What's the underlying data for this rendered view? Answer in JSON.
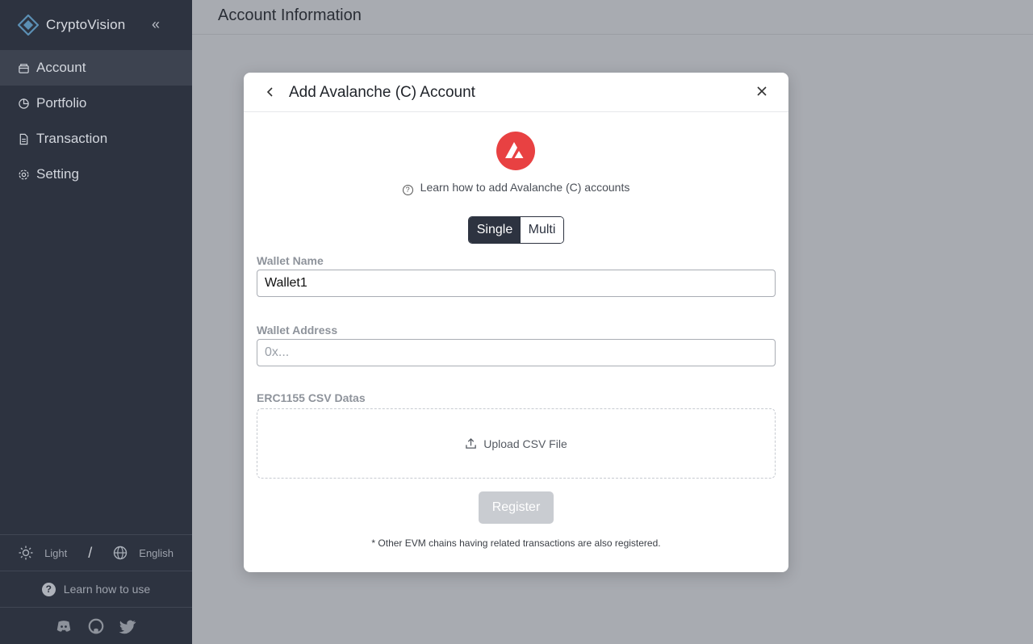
{
  "app": {
    "name": "CryptoVision"
  },
  "sidebar": {
    "items": [
      {
        "label": "Account",
        "icon": "wallet-icon",
        "active": true
      },
      {
        "label": "Portfolio",
        "icon": "pie-chart-icon",
        "active": false
      },
      {
        "label": "Transaction",
        "icon": "document-icon",
        "active": false
      },
      {
        "label": "Setting",
        "icon": "gear-icon",
        "active": false
      }
    ],
    "theme_label": "Light",
    "separator": "/",
    "language_label": "English",
    "help_label": "Learn how to use",
    "social": [
      "discord-icon",
      "github-icon",
      "twitter-icon"
    ]
  },
  "header": {
    "title": "Account Information"
  },
  "modal": {
    "title": "Add Avalanche (C) Account",
    "learn_text": "Learn how to add Avalanche (C) accounts",
    "segment": {
      "single": "Single",
      "multi": "Multi",
      "selected": "Single"
    },
    "wallet_name": {
      "label": "Wallet Name",
      "value": "Wallet1"
    },
    "wallet_address": {
      "label": "Wallet Address",
      "placeholder": "0x..."
    },
    "csv": {
      "label": "ERC1155 CSV Datas",
      "upload_label": "Upload CSV File"
    },
    "register_label": "Register",
    "note": "* Other EVM chains having related transactions are also registered."
  },
  "colors": {
    "sidebar_bg": "#2d3340",
    "avalanche_red": "#e84142",
    "register_disabled": "#c9ccd1"
  }
}
